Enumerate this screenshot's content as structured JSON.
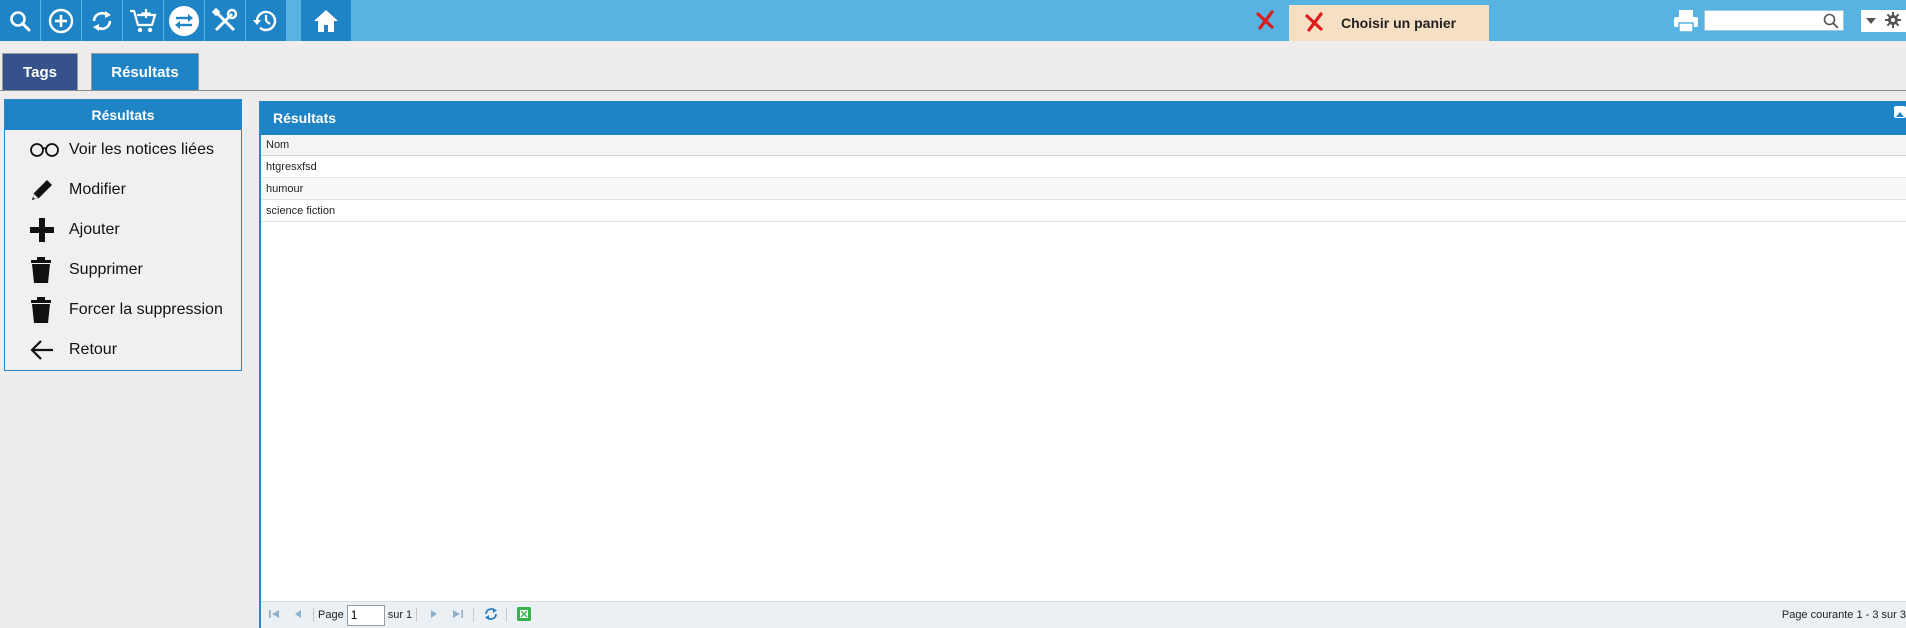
{
  "toolbar": {
    "buttons": [
      {
        "name": "search-button",
        "icon": "search-icon"
      },
      {
        "name": "add-button",
        "icon": "plus-circle-icon"
      },
      {
        "name": "refresh-button",
        "icon": "refresh-icon"
      },
      {
        "name": "cart-button",
        "icon": "add-to-cart-icon"
      },
      {
        "name": "switch-button",
        "icon": "swap-icon"
      },
      {
        "name": "tools-button",
        "icon": "tools-icon"
      },
      {
        "name": "history-button",
        "icon": "history-icon"
      },
      {
        "name": "home-button",
        "icon": "home-icon"
      }
    ],
    "basket_label": "Choisir un panier",
    "search": {
      "value": "",
      "placeholder": ""
    }
  },
  "tabs": {
    "tags": "Tags",
    "resultats": "Résultats"
  },
  "actions": {
    "title": "Résultats",
    "items": [
      {
        "label": "Voir les notices liées",
        "icon": "glasses-icon"
      },
      {
        "label": "Modifier",
        "icon": "pencil-icon"
      },
      {
        "label": "Ajouter",
        "icon": "plus-icon"
      },
      {
        "label": "Supprimer",
        "icon": "trash-icon"
      },
      {
        "label": "Forcer la suppression",
        "icon": "trash-icon"
      },
      {
        "label": "Retour",
        "icon": "arrow-left-icon"
      }
    ]
  },
  "grid": {
    "title": "Résultats",
    "column": "Nom",
    "rows": [
      "htgresxfsd",
      "humour",
      "science fiction"
    ]
  },
  "pager": {
    "page_label": "Page",
    "page_value": "1",
    "of_label": "sur 1",
    "info": "Page courante 1 - 3 sur 3"
  },
  "colors": {
    "toolbar_bg": "#57b4e2",
    "button_bg": "#1f84c6",
    "tag_tab_bg": "#36528c",
    "basket_bg": "#f7dfc3",
    "cancel_red": "#e01b1b"
  }
}
